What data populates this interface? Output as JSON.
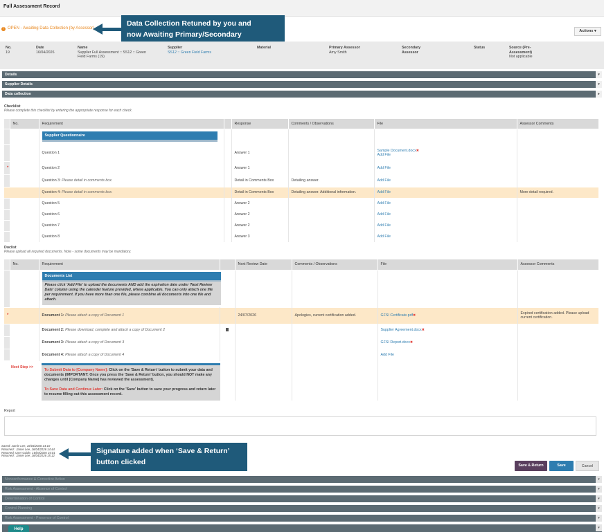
{
  "page": {
    "title": "Full Assessment Record"
  },
  "status": {
    "text": "OPEN - Awaiting Data Collection (by Assessor)"
  },
  "actions": {
    "label": "Actions",
    "chevron": "▾"
  },
  "callouts": {
    "top_line1": "Data Collection Retuned by you and",
    "top_line2": "now Awaiting Primary/Secondary",
    "bottom_line1": "Signature added when ‘Save & Return’",
    "bottom_line2": "button clicked"
  },
  "summary": {
    "no_label": "No.",
    "no_value": "19",
    "date_label": "Date",
    "date_value": "16/04/2026",
    "name_label": "Name",
    "name_value1": "Supplier Full Assessment :: SS12 :: Green",
    "name_value2": "Field Farms (19)",
    "supplier_label": "Supplier",
    "supplier_value": "SS12 :: Green Field Farms",
    "material_label": "Material",
    "primary_label": "Primary Assessor",
    "primary_value": "Amy Smith",
    "secondary_label1": "Secondary",
    "secondary_label2": "Assessor",
    "status_label": "Status",
    "source_label1": "Source (Pre-",
    "source_label2": "Assessment)",
    "source_value": "Not applicable"
  },
  "sections": {
    "details": "Details",
    "supplier_details": "Supplier Details",
    "data_collection": "Data collection"
  },
  "checklist": {
    "title": "Checklist",
    "subtitle": "Please complete this checklist by entering the appropriate response for each check.",
    "headers": {
      "no": "No.",
      "requirement": "Requirement",
      "response": "Response",
      "comments": "Comments / Observations",
      "file": "File",
      "assessor": "Assessor Comments"
    },
    "group": "Supplier Questionnaire",
    "rows": [
      {
        "mark": "",
        "req": "Question 1",
        "resp": "Answer 1",
        "comm": "",
        "file": "Sample Document.docx",
        "file2": "Add File",
        "assessor": ""
      },
      {
        "mark": "*",
        "req": "Question 2",
        "resp": "Answer 1",
        "comm": "",
        "file": "Add File",
        "assessor": ""
      },
      {
        "mark": "",
        "req": "Question 3: ",
        "req_i": "Please detail in comments box.",
        "resp": "Detail in Comments Box",
        "comm": "Detailing answer.",
        "file": "Add File",
        "assessor": ""
      },
      {
        "mark": "",
        "req": "Question 4: ",
        "req_i": "Please detail in comments box.",
        "resp": "Detail in Comments Box",
        "comm": "Detailing answer. Additional information.",
        "file": "Add File",
        "assessor": "More detail required."
      },
      {
        "mark": "",
        "req": "Question 5",
        "resp": "Answer 2",
        "comm": "",
        "file": "Add File",
        "assessor": ""
      },
      {
        "mark": "",
        "req": "Question 6",
        "resp": "Answer 2",
        "comm": "",
        "file": "Add File",
        "assessor": ""
      },
      {
        "mark": "",
        "req": "Question 7",
        "resp": "Answer 2",
        "comm": "",
        "file": "Add File",
        "assessor": ""
      },
      {
        "mark": "",
        "req": "Question 8",
        "resp": "Answer 3",
        "comm": "",
        "file": "Add File",
        "assessor": ""
      }
    ]
  },
  "doclist": {
    "title": "Doclist",
    "subtitle": "Please upload all required documents. Note - some documents may be mandatory.",
    "headers": {
      "no": "No.",
      "requirement": "Requirement",
      "next_review": "Next Review Date",
      "comments": "Comments / Observations",
      "file": "File",
      "assessor": "Assessor Comments"
    },
    "box_title": "Documents List",
    "box_body": "Please click 'Add File' to upload the documents AND add the expiration date under 'Next Review Date' column using the calendar feature provided, where applicable. You can only attach one file per requirement. If you have more than one file, please combine all documents into one file and attach.",
    "rows": [
      {
        "mark": "*",
        "req": "Document 1: ",
        "req_i": "Please attach a copy of Document 1",
        "date": "24/07/2026",
        "comm": "Apologies, current certification added.",
        "file": "GFSI Certificate.pdf",
        "assessor": "Expired certification added. Please upload current certification."
      },
      {
        "mark": "",
        "req": "Document 2: ",
        "req_i": "Please download, complete and attach a copy of Document 2",
        "date": "",
        "comm": "",
        "file": "Supplier Agreement.docx",
        "assessor": ""
      },
      {
        "mark": "",
        "req": "Document 3: ",
        "req_i": "Please attach a copy of Document 3",
        "date": "",
        "comm": "",
        "file": "GFSI Report.docx",
        "assessor": ""
      },
      {
        "mark": "",
        "req": "Document 4: ",
        "req_i": "Please attach a copy of Document 4",
        "date": "",
        "comm": "",
        "file": "Add File",
        "assessor": ""
      }
    ],
    "next_step": "Next Step >>",
    "submit_red": "To Submit Data to [Company Name]:",
    "submit_text": " Click on the 'Save & Return' button to submit your data and documents (IMPORTANT: Once you press the 'Save & Return' button, you should NOT make any changes until [Company Name] has reviewed the assessment).",
    "save_red": "To Save Data and Continue Later:",
    "save_text": " Click on the 'Save' button to save your progress and return later to resume filling out this assessment record."
  },
  "report": {
    "label": "Report"
  },
  "signatures": [
    "Saved: Jamie Lee, 16/04/2026 14:10",
    "Returned : Jamie Lee, 16/04/2026 14:44",
    "Returned: User Guide, 16/04/2026 15:01",
    "Returned : Jamie Lee, 16/04/2026 15:12"
  ],
  "buttons": {
    "save_return": "Save & Return",
    "save": "Save",
    "cancel": "Cancel"
  },
  "lower_sections": [
    "Nonconformance & Corrective Action",
    "Risk Assessment - Absence of Control",
    "Determination of Control",
    "Control Planning",
    "Risk Assessment - Presence of Control"
  ],
  "help": {
    "label": "Help"
  },
  "colors": {
    "accent": "#2e7db0",
    "callout": "#1f5a7a",
    "section_bar": "#5c6b73",
    "highlight": "#fde8c8",
    "required": "#e0413b",
    "status": "#e8871e",
    "save_return": "#5a3f5e"
  }
}
